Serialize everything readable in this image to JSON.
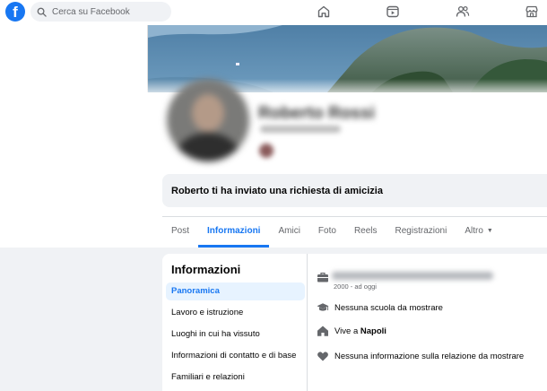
{
  "topbar": {
    "logo_letter": "f",
    "search_placeholder": "Cerca su Facebook",
    "nav_icons": [
      "home-icon",
      "video-icon",
      "friends-icon",
      "marketplace-icon"
    ]
  },
  "profile": {
    "name": "Roberto Rossi",
    "friend_request_text": "Roberto ti ha inviato una richiesta di amicizia"
  },
  "tabs": [
    {
      "label": "Post",
      "active": false
    },
    {
      "label": "Informazioni",
      "active": true
    },
    {
      "label": "Amici",
      "active": false
    },
    {
      "label": "Foto",
      "active": false
    },
    {
      "label": "Reels",
      "active": false
    },
    {
      "label": "Registrazioni",
      "active": false
    },
    {
      "label": "Altro",
      "active": false,
      "has_caret": true
    }
  ],
  "about": {
    "title": "Informazioni",
    "menu": [
      "Panoramica",
      "Lavoro e istruzione",
      "Luoghi in cui ha vissuto",
      "Informazioni di contatto e di base",
      "Familiari e relazioni"
    ],
    "active_index": 0,
    "overview": {
      "work_since": "2000 - ad oggi",
      "school": "Nessuna scuola da mostrare",
      "lives_in_prefix": "Vive a ",
      "lives_in_city": "Napoli",
      "relationship": "Nessuna informazione sulla relazione da mostrare"
    }
  },
  "colors": {
    "accent": "#1877f2",
    "background": "#f0f2f5",
    "text_secondary": "#65676b",
    "active_item_bg": "#e7f3ff"
  }
}
